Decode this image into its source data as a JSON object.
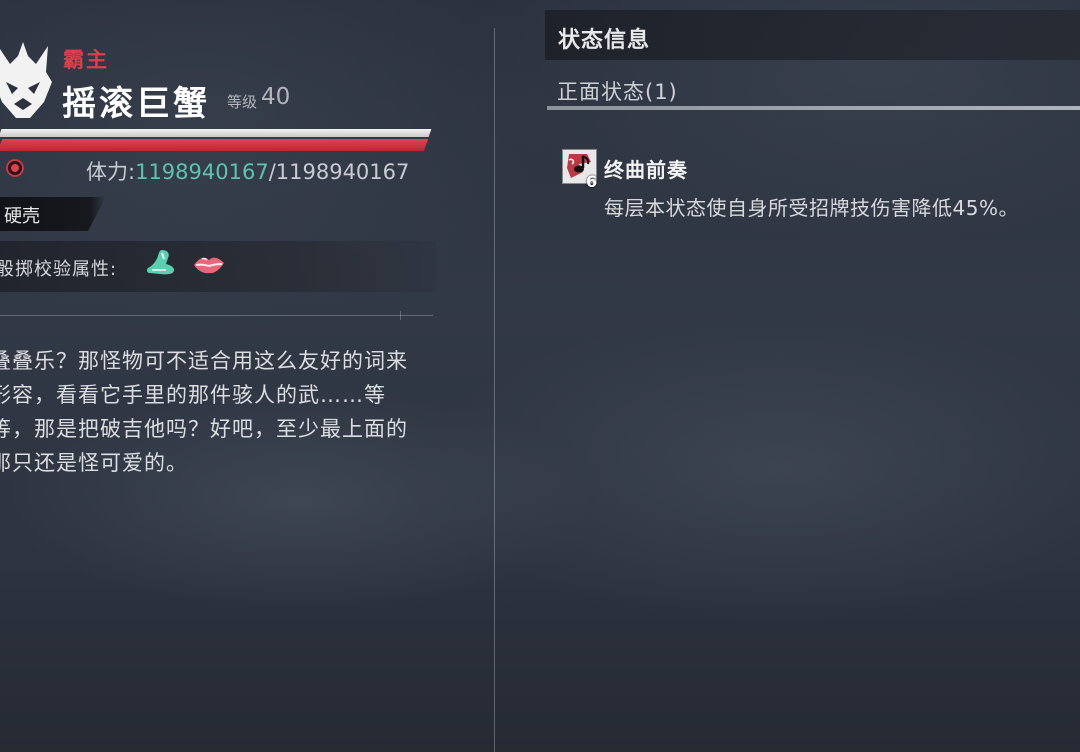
{
  "boss": {
    "rank": "霸主",
    "name": "摇滚巨蟹",
    "level_prefix": "等级",
    "level": "40",
    "hp_label": "体力:",
    "hp_current": "1198940167",
    "hp_separator": "/",
    "hp_max": "1198940167",
    "hp_fraction": 1.0,
    "trait": "硬壳",
    "check_attr_label": "骰掷校验属性:",
    "check_attr_icons": [
      "foot-icon",
      "lips-icon"
    ],
    "description": [
      "叠叠乐？那怪物可不适合用这么友好的词来",
      "形容，看看它手里的那件骇人的武……等",
      "等，那是把破吉他吗？好吧，至少最上面的",
      "那只还是怪可爱的。"
    ]
  },
  "status_panel": {
    "title": "状态信息",
    "positive_label": "正面状态(1)",
    "effects": [
      {
        "icon": "music-note-icon",
        "stack": "6",
        "name": "终曲前奏",
        "description": "每层本状态使自身所受招牌技伤害降低45%。"
      }
    ]
  },
  "colors": {
    "rank": "#d8414b",
    "hp_value": "#5fc3ad",
    "hp_fill": "#e04450"
  }
}
